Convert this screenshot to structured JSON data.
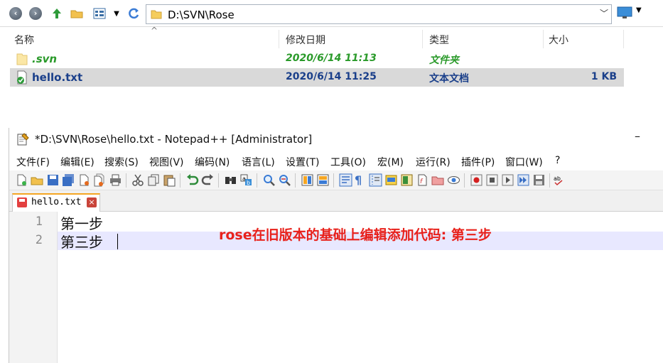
{
  "explorer": {
    "address": "D:\\SVN\\Rose",
    "columns": [
      "名称",
      "修改日期",
      "类型",
      "大小"
    ],
    "files": [
      {
        "name": ".svn",
        "date": "2020/6/14 11:13",
        "type": "文件夹",
        "size": ""
      },
      {
        "name": "hello.txt",
        "date": "2020/6/14 11:25",
        "type": "文本文档",
        "size": "1 KB"
      }
    ]
  },
  "notepad": {
    "title": "*D:\\SVN\\Rose\\hello.txt - Notepad++ [Administrator]",
    "minimize": "–",
    "menu": [
      "文件(F)",
      "编辑(E)",
      "搜索(S)",
      "视图(V)",
      "编码(N)",
      "语言(L)",
      "设置(T)",
      "工具(O)",
      "宏(M)",
      "运行(R)",
      "插件(P)",
      "窗口(W)",
      "?"
    ],
    "tab": {
      "label": "hello.txt",
      "close": "×"
    },
    "lines": [
      {
        "num": "1",
        "text": "第一步"
      },
      {
        "num": "2",
        "text": "第三步"
      }
    ]
  },
  "annotation": "rose在旧版本的基础上编辑添加代码: 第三步",
  "colors": {
    "svn_green": "#2a9a2a",
    "file_blue": "#1a3f8a",
    "annotation_red": "#e8211b",
    "tab_accent": "#f5a623"
  }
}
